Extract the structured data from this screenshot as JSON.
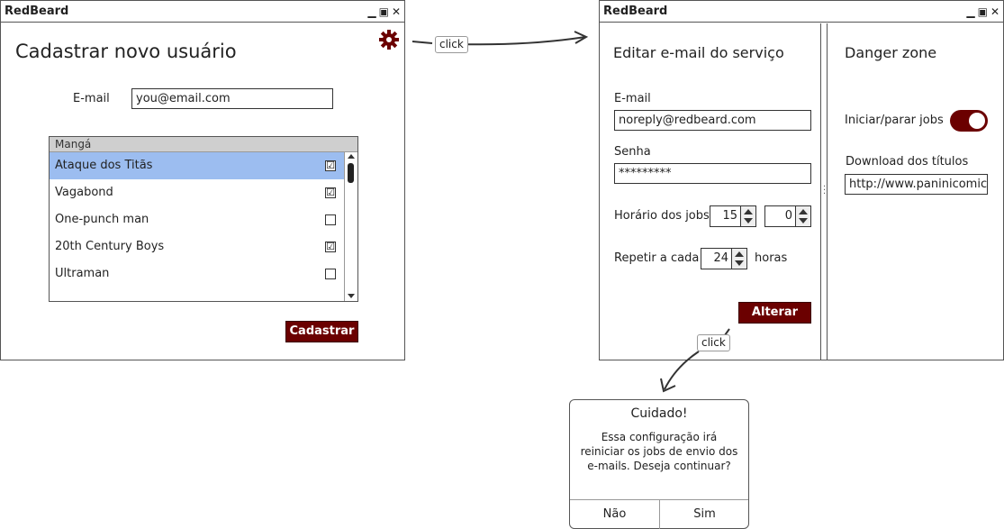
{
  "left_window": {
    "title": "RedBeard",
    "heading": "Cadastrar novo usuário",
    "email_label": "E-mail",
    "email_value": "you@email.com",
    "list_header": "Mangá",
    "items": [
      {
        "label": "Ataque dos Titãs",
        "checked": "☑",
        "selected": true
      },
      {
        "label": "Vagabond",
        "checked": "☑",
        "selected": false
      },
      {
        "label": "One-punch man",
        "checked": "",
        "selected": false
      },
      {
        "label": "20th Century Boys",
        "checked": "☑",
        "selected": false
      },
      {
        "label": "Ultraman",
        "checked": "",
        "selected": false
      }
    ],
    "submit_label": "Cadastrar",
    "settings_icon": "gear-icon"
  },
  "arrow_note_top": "click",
  "right_window": {
    "title": "RedBeard",
    "edit_heading": "Editar e-mail do serviço",
    "email_label": "E-mail",
    "email_value": "noreply@redbeard.com",
    "password_label": "Senha",
    "password_value": "*********",
    "jobs_time_label": "Horário dos jobs",
    "jobs_hour": "15",
    "jobs_minute": "0",
    "repeat_label": "Repetir a cada",
    "repeat_value": "24",
    "repeat_unit": "horas",
    "change_label": "Alterar",
    "danger_heading": "Danger zone",
    "toggle_label": "Iniciar/parar jobs",
    "download_label": "Download dos títulos",
    "download_url": "http://www.paninicomics.c"
  },
  "arrow_note_bottom": "click",
  "dialog": {
    "title": "Cuidado!",
    "message_line1": "Essa configuração irá",
    "message_line2": "reiniciar os jobs de envio dos",
    "message_line3": "e-mails. Deseja continuar?",
    "no_label": "Não",
    "yes_label": "Sim"
  },
  "colors": {
    "accent": "#6b0000",
    "selection": "#9cbdf0"
  }
}
